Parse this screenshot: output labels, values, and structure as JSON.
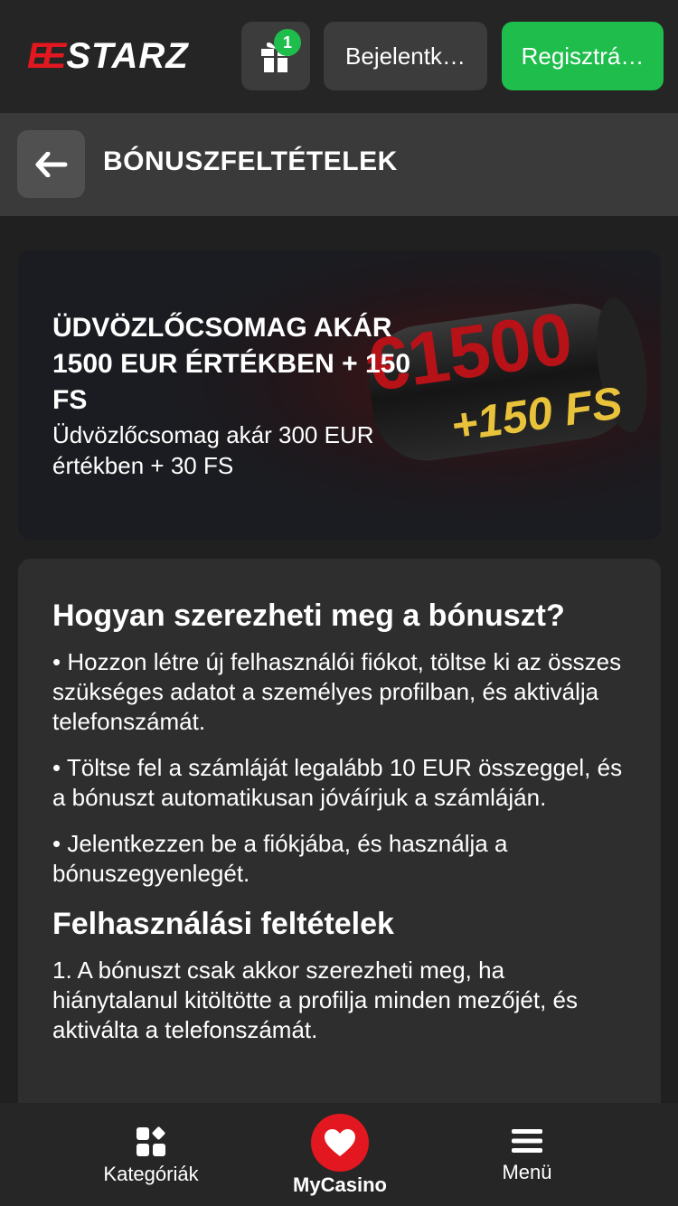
{
  "header": {
    "logo_prefix": "EE",
    "logo_text": "STARZ",
    "gift_badge": "1",
    "login_label": "Bejelentk…",
    "register_label": "Regisztrá…"
  },
  "subheader": {
    "title": "BÓNUSZFELTÉTELEK"
  },
  "banner": {
    "title": "ÜDVÖZLŐCSOMAG AKÁR 1500 EUR ÉRTÉKBEN + 150 FS",
    "subtitle": "Üdvözlőcsomag akár 300 EUR értékben + 30 FS",
    "art_amount": "€1500",
    "art_fs": "+150 FS"
  },
  "content": {
    "how_heading": "Hogyan szerezheti meg a bónuszt?",
    "steps": [
      "• Hozzon létre új felhasználói fiókot, töltse ki az összes szükséges adatot a személyes profilban, és aktiválja telefonszámát.",
      "• Töltse fel a számláját legalább 10 EUR összeggel, és a bónuszt automatikusan jóváírjuk a számláján.",
      "• Jelentkezzen be a fiókjába, és használja a bónuszegyenlegét."
    ],
    "terms_heading": "Felhasználási feltételek",
    "terms": [
      "1. A bónuszt csak akkor szerezheti meg, ha hiánytalanul kitöltötte a profilja minden mezőjét, és aktiválta a telefonszámát."
    ]
  },
  "bottom_nav": {
    "categories_label": "Kategóriák",
    "mycasino_label": "MyCasino",
    "menu_label": "Menü"
  },
  "colors": {
    "brand_red": "#e3171f",
    "accent_green": "#1fbd4c",
    "background": "#202020"
  }
}
